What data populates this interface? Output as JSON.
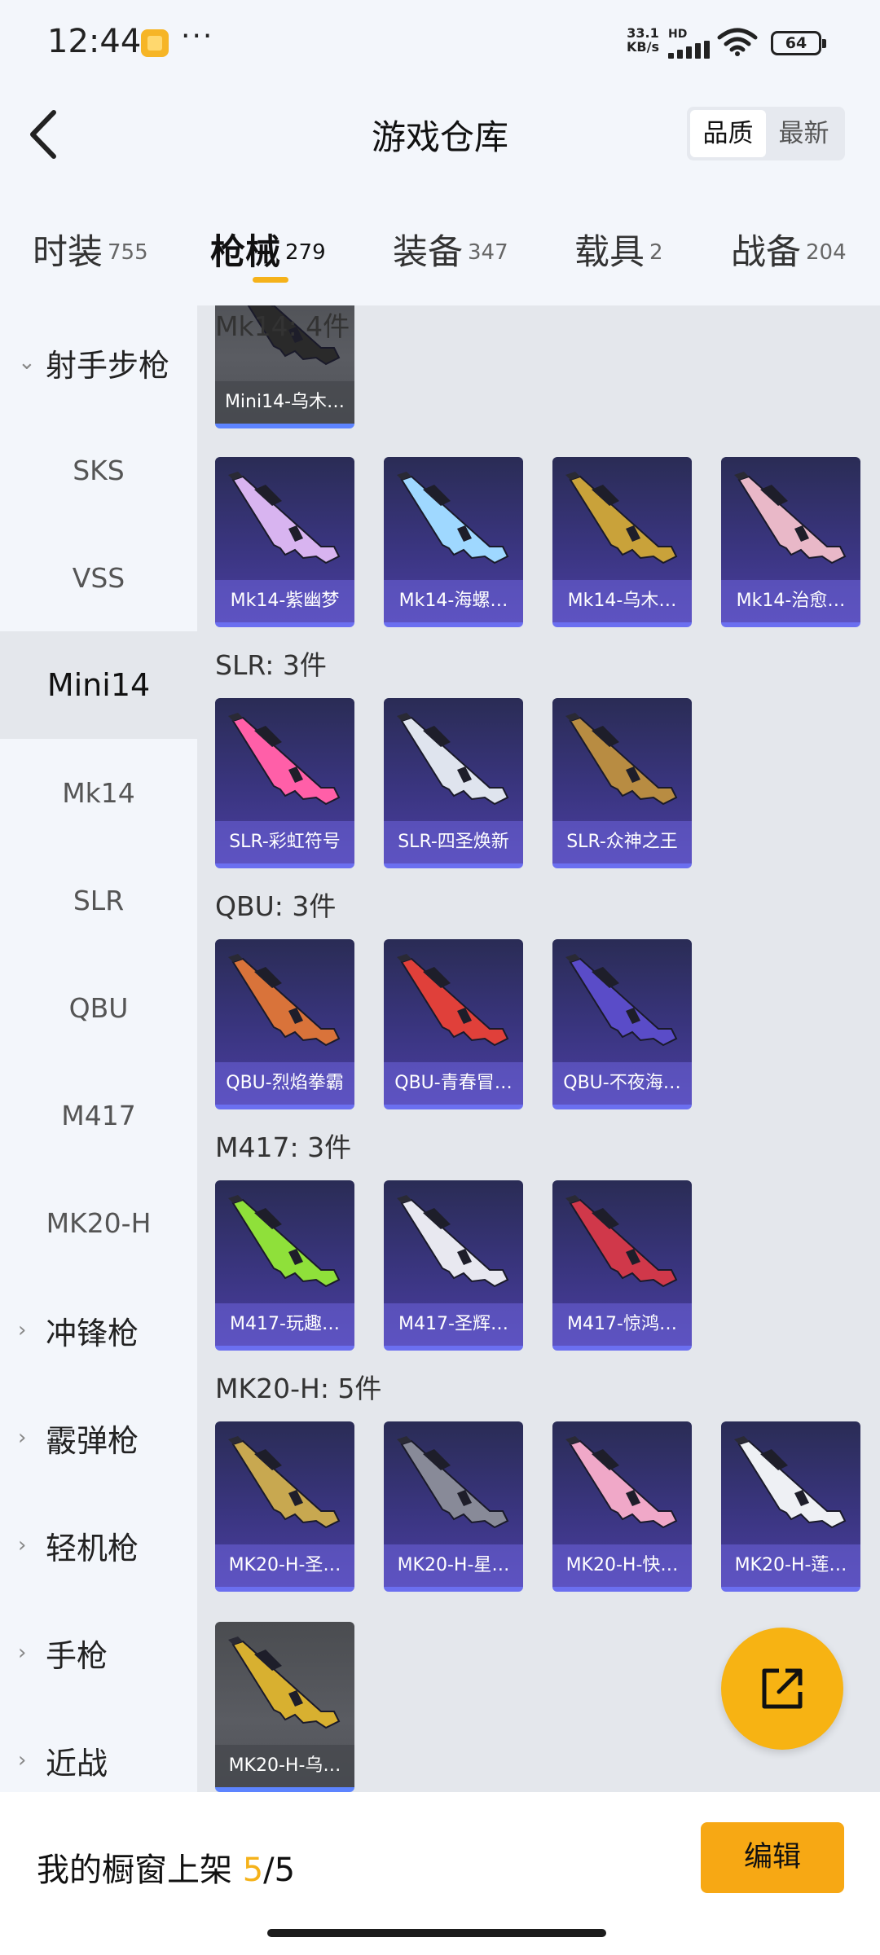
{
  "status_bar": {
    "time": "12:44",
    "dots": "···",
    "net_speed": "33.1",
    "net_unit": "KB/s",
    "hd": "HD",
    "battery": "64"
  },
  "header": {
    "title": "游戏仓库",
    "sort_options": [
      "品质",
      "最新"
    ],
    "sort_active": "品质"
  },
  "tabs": [
    {
      "label": "时装",
      "count": "755"
    },
    {
      "label": "枪械",
      "count": "279",
      "active": true
    },
    {
      "label": "装备",
      "count": "347"
    },
    {
      "label": "载具",
      "count": "2"
    },
    {
      "label": "战备",
      "count": "204"
    }
  ],
  "sidebar": {
    "items": [
      {
        "label": "射手步枪",
        "type": "category",
        "expanded": true
      },
      {
        "label": "SKS"
      },
      {
        "label": "VSS"
      },
      {
        "label": "Mini14",
        "active": true
      },
      {
        "label": "Mk14"
      },
      {
        "label": "SLR"
      },
      {
        "label": "QBU"
      },
      {
        "label": "M417"
      },
      {
        "label": "MK20-H"
      },
      {
        "label": "冲锋枪",
        "type": "category"
      },
      {
        "label": "霰弹枪",
        "type": "category"
      },
      {
        "label": "轻机枪",
        "type": "category"
      },
      {
        "label": "手枪",
        "type": "category"
      },
      {
        "label": "近战",
        "type": "category"
      }
    ]
  },
  "content": {
    "partial_card": "Mini14-乌木…",
    "groups": [
      {
        "title": "Mk14: 4件",
        "items": [
          "Mk14-紫幽梦",
          "Mk14-海螺…",
          "Mk14-乌木…",
          "Mk14-治愈…"
        ]
      },
      {
        "title": "SLR: 3件",
        "items": [
          "SLR-彩虹符号",
          "SLR-四圣焕新",
          "SLR-众神之王"
        ]
      },
      {
        "title": "QBU: 3件",
        "items": [
          "QBU-烈焰拳霸",
          "QBU-青春冒…",
          "QBU-不夜海…"
        ]
      },
      {
        "title": "M417: 3件",
        "items": [
          "M417-玩趣…",
          "M417-圣辉…",
          "M417-惊鸿…"
        ]
      },
      {
        "title": "MK20-H: 5件",
        "items": [
          "MK20-H-圣…",
          "MK20-H-星…",
          "MK20-H-快…",
          "MK20-H-莲…",
          "MK20-H-乌…"
        ]
      }
    ]
  },
  "weapon_colors": {
    "Mk14-紫幽梦": "#d8b4f0",
    "Mk14-海螺…": "#9fd8ff",
    "Mk14-乌木…": "#c9a23a",
    "Mk14-治愈…": "#e9b8c8",
    "SLR-彩虹符号": "#ff5fa8",
    "SLR-四圣焕新": "#dfe4ee",
    "SLR-众神之王": "#b88c42",
    "QBU-烈焰拳霸": "#d9733a",
    "QBU-青春冒…": "#e0403a",
    "QBU-不夜海…": "#5a4cc8",
    "M417-玩趣…": "#8fe03a",
    "M417-圣辉…": "#e8e8f0",
    "M417-惊鸿…": "#d0384a",
    "MK20-H-圣…": "#c8a850",
    "MK20-H-星…": "#888a98",
    "MK20-H-快…": "#f0a8c8",
    "MK20-H-莲…": "#eef0f4",
    "MK20-H-乌…": "#d8b030",
    "Mini14-乌木…": "#2a2a2a"
  },
  "bottom_bar": {
    "label": "我的橱窗上架",
    "current": "5",
    "separator": "/",
    "total": "5",
    "edit_label": "编辑"
  },
  "colors": {
    "accent": "#f5b21a",
    "card_bg": "#3a3580",
    "card_border": "#6b6ff0"
  }
}
